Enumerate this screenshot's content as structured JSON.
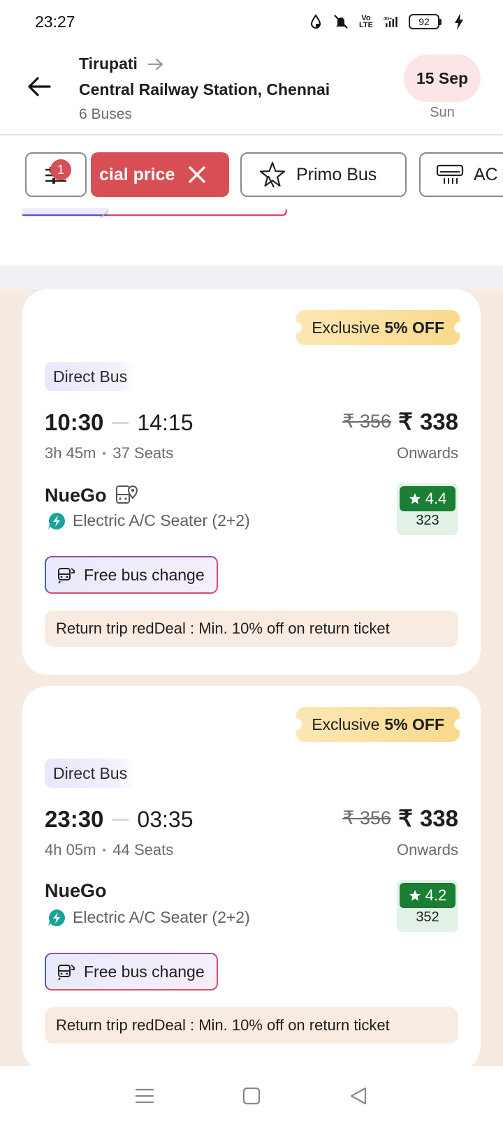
{
  "status_bar": {
    "time": "23:27",
    "battery": "92"
  },
  "header": {
    "from": "Tirupati",
    "to": "Central Railway Station, Chennai",
    "bus_count": "6 Buses",
    "date": "15 Sep",
    "day": "Sun"
  },
  "filters": {
    "filter_badge": "1",
    "special_price_label": "cial price",
    "primo_label": "Primo Bus",
    "ac_label": "AC"
  },
  "buses": [
    {
      "offer_prefix": "Exclusive",
      "offer_value": "5% OFF",
      "direct_label": "Direct Bus",
      "departure": "10:30",
      "arrival": "14:15",
      "duration": "3h 45m",
      "seats": "37 Seats",
      "old_price": "₹ 356",
      "currency": "₹",
      "price": "338",
      "onwards": "Onwards",
      "operator": "NueGo",
      "bus_type": "Electric A/C Seater (2+2)",
      "rating": "4.4",
      "rating_count": "323",
      "free_change": "Free bus change",
      "redeal": "Return trip redDeal : Min. 10% off on return ticket"
    },
    {
      "offer_prefix": "Exclusive",
      "offer_value": "5% OFF",
      "direct_label": "Direct Bus",
      "departure": "23:30",
      "arrival": "03:35",
      "duration": "4h 05m",
      "seats": "44 Seats",
      "old_price": "₹ 356",
      "currency": "₹",
      "price": "338",
      "onwards": "Onwards",
      "operator": "NueGo",
      "bus_type": "Electric A/C Seater (2+2)",
      "rating": "4.2",
      "rating_count": "352",
      "free_change": "Free bus change",
      "redeal": "Return trip redDeal : Min. 10% off on return ticket"
    }
  ],
  "colors": {
    "accent_red": "#d84e55",
    "rating_green": "#1a7e34",
    "results_bg": "#f6eae1"
  }
}
